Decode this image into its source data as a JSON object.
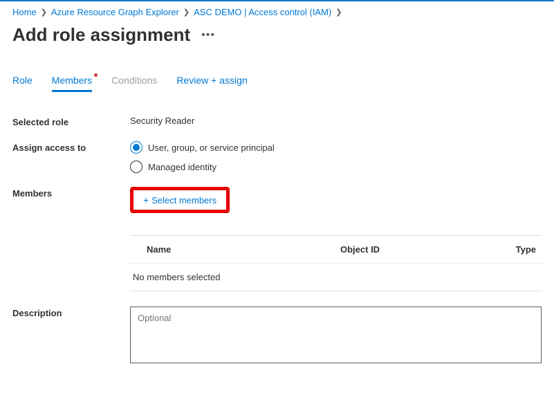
{
  "breadcrumb": {
    "items": [
      {
        "label": "Home"
      },
      {
        "label": "Azure Resource Graph Explorer"
      },
      {
        "label": "ASC DEMO | Access control (IAM)"
      }
    ]
  },
  "page": {
    "title": "Add role assignment"
  },
  "tabs": [
    {
      "label": "Role",
      "state": "link"
    },
    {
      "label": "Members",
      "state": "active",
      "dot": true
    },
    {
      "label": "Conditions",
      "state": "disabled"
    },
    {
      "label": "Review + assign",
      "state": "link"
    }
  ],
  "form": {
    "selected_role": {
      "label": "Selected role",
      "value": "Security Reader"
    },
    "assign_access": {
      "label": "Assign access to",
      "options": [
        {
          "label": "User, group, or service principal",
          "checked": true
        },
        {
          "label": "Managed identity",
          "checked": false
        }
      ]
    },
    "members": {
      "label": "Members",
      "select_button": "Select members",
      "table_headers": {
        "name": "Name",
        "object_id": "Object ID",
        "type": "Type"
      },
      "empty_text": "No members selected"
    },
    "description": {
      "label": "Description",
      "placeholder": "Optional"
    }
  }
}
